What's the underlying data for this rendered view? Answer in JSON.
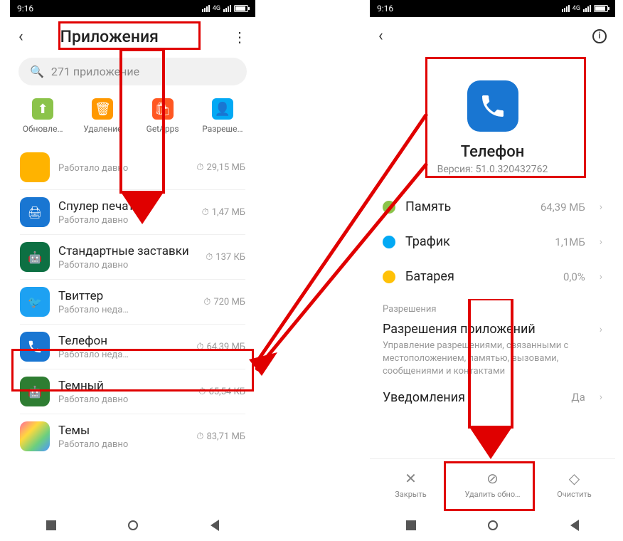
{
  "status": {
    "time": "9:16",
    "net": "4G"
  },
  "left": {
    "title": "Приложения",
    "search_placeholder": "271 приложение",
    "cats": [
      {
        "label": "Обновле…"
      },
      {
        "label": "Удаление"
      },
      {
        "label": "GetApps"
      },
      {
        "label": "Разреше…"
      }
    ],
    "apps": [
      {
        "name": "",
        "sub": "Работало давно",
        "size": "29,15 МБ",
        "icon": "ai-yellow"
      },
      {
        "name": "Спулер печати",
        "sub": "Работало давно",
        "size": "1,47 МБ",
        "icon": "ai-blue"
      },
      {
        "name": "Стандартные заставки",
        "sub": "Работало давно",
        "size": "137 КБ",
        "icon": "ai-green"
      },
      {
        "name": "Твиттер",
        "sub": "Работало неда…",
        "size": "720 МБ",
        "icon": "ai-twitter"
      },
      {
        "name": "Телефон",
        "sub": "Работало неда…",
        "size": "64,39 МБ",
        "icon": "ai-blue"
      },
      {
        "name": "Темный",
        "sub": "Работало давно",
        "size": "65,54 КБ",
        "icon": "ai-dgreen"
      },
      {
        "name": "Темы",
        "sub": "Работало давно",
        "size": "83,71 МБ",
        "icon": "ai-grad"
      }
    ]
  },
  "right": {
    "app_name": "Телефон",
    "version": "Версия: 51.0.320432762",
    "rows": [
      {
        "label": "Память",
        "value": "64,39 МБ",
        "color": "#8bc34a"
      },
      {
        "label": "Трафик",
        "value": "1,1МБ",
        "color": "#03a9f4"
      },
      {
        "label": "Батарея",
        "value": "0,0%",
        "color": "#ffc107"
      }
    ],
    "perm_section": "Разрешения",
    "perm_title": "Разрешения приложений",
    "perm_desc": "Управление разрешениями, связанными с местоположением, памятью, вызовами, сообщениями и контактами",
    "notif_label": "Уведомления",
    "notif_val": "Да",
    "actions": [
      {
        "label": "Закрыть",
        "icon": "✕"
      },
      {
        "label": "Удалить обно…",
        "icon": "⊘"
      },
      {
        "label": "Очистить",
        "icon": "◇"
      }
    ]
  }
}
